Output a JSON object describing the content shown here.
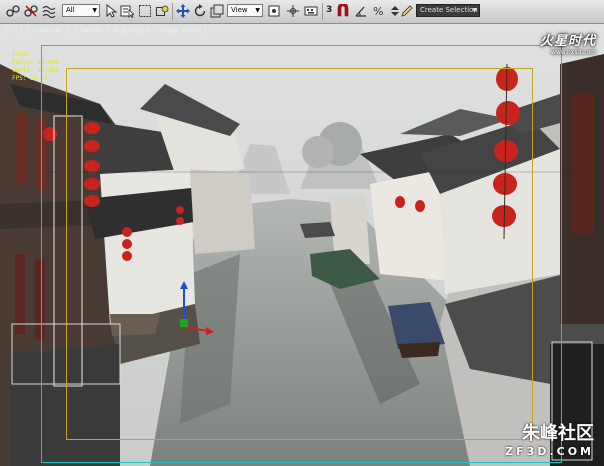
{
  "toolbar": {
    "selection_filter": "All",
    "reference_coordinate": "View",
    "snap_label": "3",
    "named_selection_set": "Create Selection Se",
    "icons": [
      "select-link-icon",
      "unlink-icon",
      "bind-space-warp-icon",
      "select-object-icon",
      "select-by-name-icon",
      "rect-selection-region-icon",
      "window-crossing-icon",
      "select-move-icon",
      "select-rotate-icon",
      "select-scale-icon",
      "use-pivot-center-icon",
      "manipulate-icon",
      "snaps-toggle-icon",
      "angle-snap-icon",
      "percent-snap-icon",
      "spinner-snap-icon",
      "edit-named-selections-icon"
    ]
  },
  "viewport": {
    "label": "[ + ] [ Camera01 ] [ Smooth + Highlights + Edged Faces ]",
    "stats": [
      "Total",
      "Polys: 38,043",
      "Verts: 22,981",
      "FPS: 23.31"
    ],
    "overlay_colors": {
      "safe_frame_outer": "#19c4c4",
      "safe_frame_inner": "#c8a320"
    }
  },
  "watermarks": {
    "top_right": "火星时代",
    "top_right_url": "www.hxsd.com",
    "bottom_right": "朱峰社区",
    "bottom_right_sub": "ZF3D.COM"
  }
}
